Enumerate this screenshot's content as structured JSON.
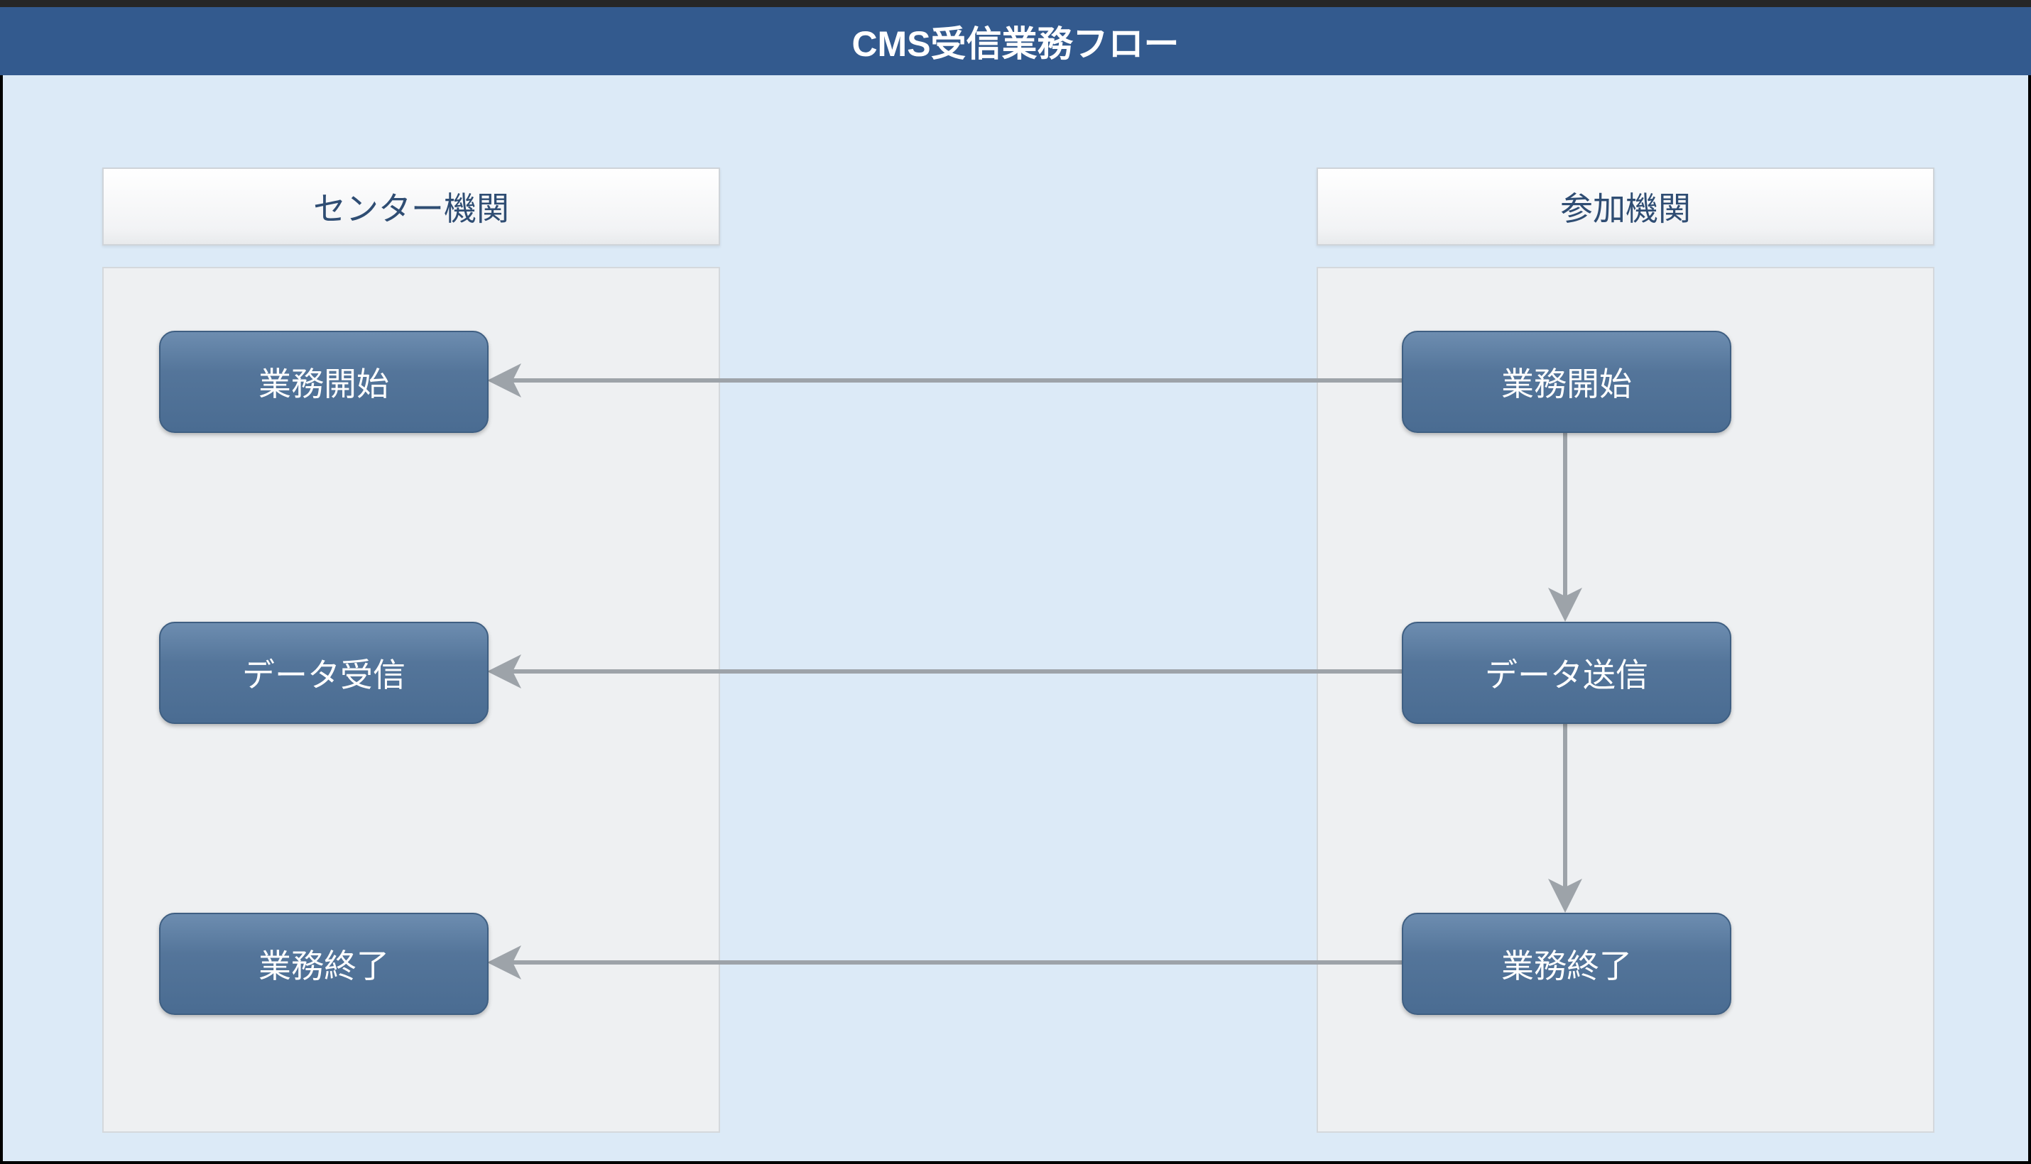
{
  "title": "CMS受信業務フロー",
  "lanes": {
    "center": {
      "label": "センター機関"
    },
    "participant": {
      "label": "参加機関"
    }
  },
  "nodes": {
    "center": {
      "start": "業務開始",
      "receive": "データ受信",
      "end": "業務終了"
    },
    "participant": {
      "start": "業務開始",
      "send": "データ送信",
      "end": "業務終了"
    }
  },
  "flows": [
    {
      "from": "participant.start",
      "to": "center.start",
      "direction": "horizontal"
    },
    {
      "from": "participant.start",
      "to": "participant.send",
      "direction": "vertical"
    },
    {
      "from": "participant.send",
      "to": "center.receive",
      "direction": "horizontal"
    },
    {
      "from": "participant.send",
      "to": "participant.end",
      "direction": "vertical"
    },
    {
      "from": "participant.end",
      "to": "center.end",
      "direction": "horizontal"
    }
  ]
}
